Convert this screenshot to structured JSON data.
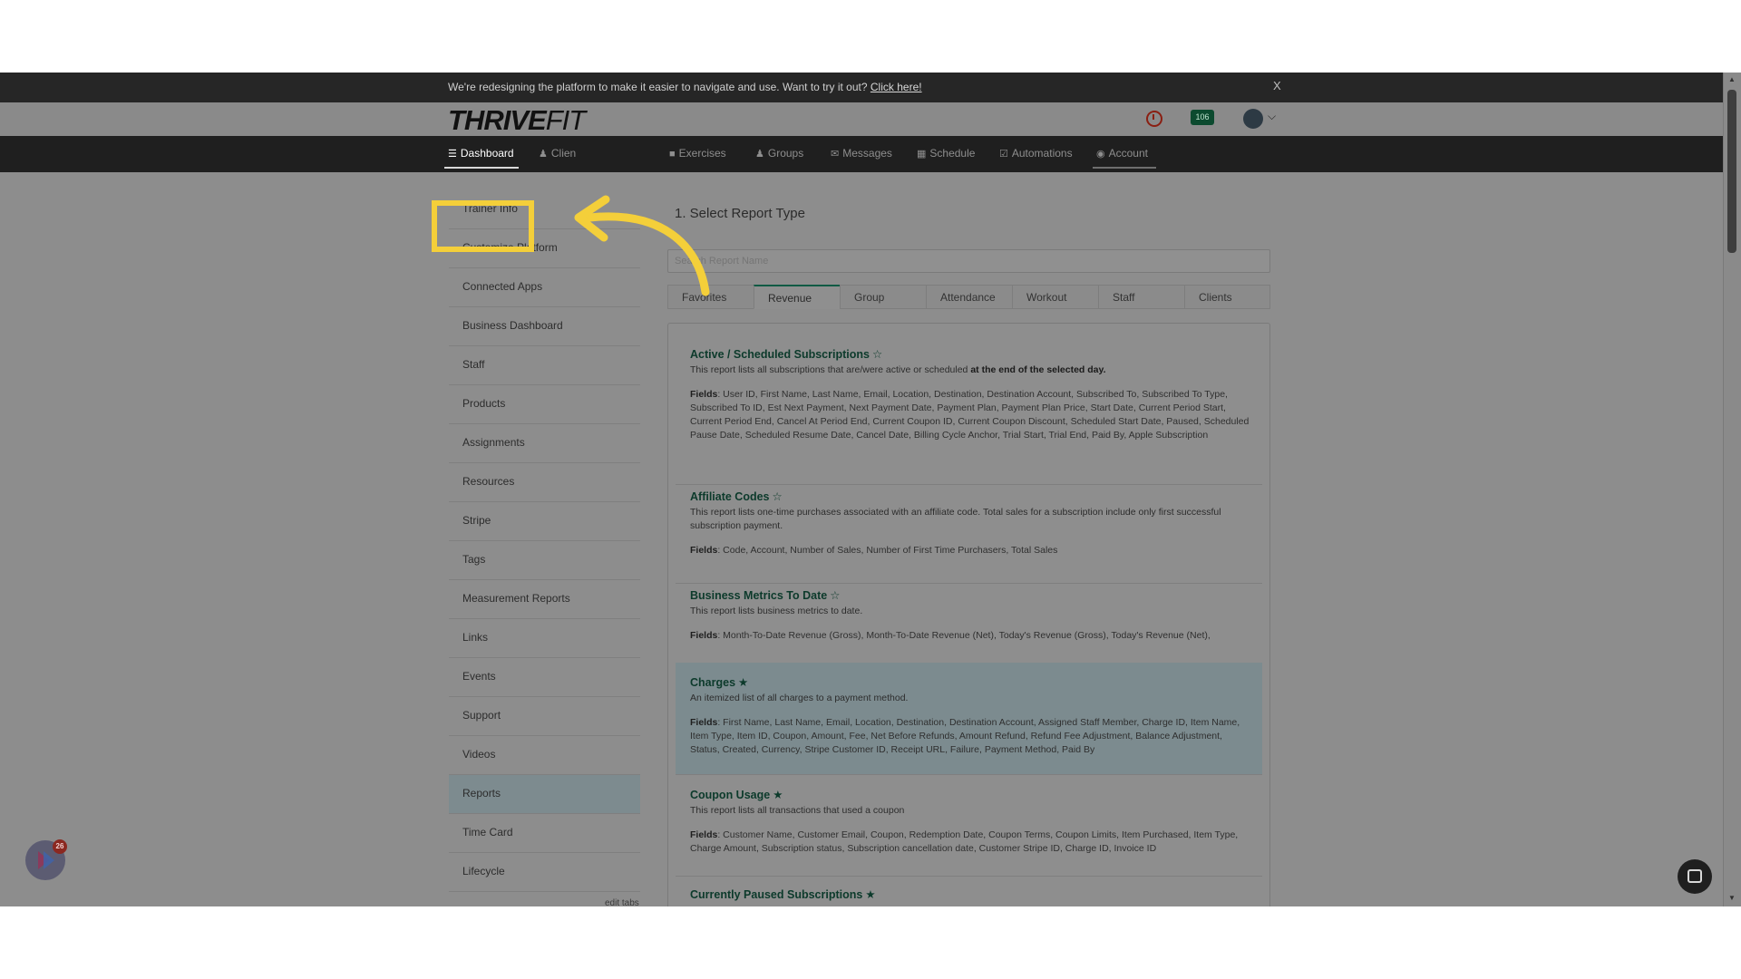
{
  "announcement": {
    "text": "We're redesigning the platform to make it easier to navigate and use. Want to try it out?",
    "link": "Click here!",
    "close": "X"
  },
  "header": {
    "logo_main": "THRIVE",
    "logo_accent": "FIT",
    "notification_count": "106"
  },
  "nav": {
    "items": [
      {
        "label": "Dashboard",
        "icon": "list-icon"
      },
      {
        "label": "Clien",
        "icon": "user-icon"
      },
      {
        "label": "Exercises",
        "icon": "dumbbell-icon"
      },
      {
        "label": "Groups",
        "icon": "users-icon"
      },
      {
        "label": "Messages",
        "icon": "envelope-icon"
      },
      {
        "label": "Schedule",
        "icon": "calendar-icon"
      },
      {
        "label": "Automations",
        "icon": "check-square-icon"
      },
      {
        "label": "Account",
        "icon": "user-circle-icon"
      }
    ]
  },
  "sidebar": {
    "items": [
      "Trainer Info",
      "Customize Platform",
      "Connected Apps",
      "Business Dashboard",
      "Staff",
      "Products",
      "Assignments",
      "Resources",
      "Stripe",
      "Tags",
      "Measurement Reports",
      "Links",
      "Events",
      "Support",
      "Videos",
      "Reports",
      "Time Card",
      "Lifecycle"
    ],
    "active": "Reports",
    "edit_tabs": "edit tabs"
  },
  "main": {
    "title": "1. Select Report Type",
    "search_placeholder": "Search Report Name",
    "tabs": [
      "Favorites",
      "Revenue",
      "Group",
      "Attendance",
      "Workout",
      "Staff",
      "Clients"
    ],
    "active_tab": "Revenue",
    "reports": [
      {
        "title": "Active / Scheduled Subscriptions",
        "star": "☆",
        "desc": "This report lists all subscriptions that are/were active or scheduled",
        "desc_bold": "at the end of the selected day.",
        "fields_label": "Fields",
        "fields": ": User ID, First Name, Last Name, Email, Location, Destination, Destination Account, Subscribed To, Subscribed To Type, Subscribed To ID, Est Next Payment, Next Payment Date, Payment Plan, Payment Plan Price, Start Date, Current Period Start, Current Period End, Cancel At Period End, Current Coupon ID, Current Coupon Discount, Scheduled Start Date, Paused, Scheduled Pause Date, Scheduled Resume Date, Cancel Date, Billing Cycle Anchor, Trial Start, Trial End, Paid By, Apple Subscription"
      },
      {
        "title": "Affiliate Codes",
        "star": "☆",
        "desc": "This report lists one-time purchases associated with an affiliate code. Total sales for a subscription include only first successful subscription payment.",
        "desc_bold": "",
        "fields_label": "Fields",
        "fields": ": Code, Account, Number of Sales, Number of First Time Purchasers, Total Sales"
      },
      {
        "title": "Business Metrics To Date",
        "star": "☆",
        "desc": "This report lists business metrics to date.",
        "desc_bold": "",
        "fields_label": "Fields",
        "fields": ": Month-To-Date Revenue (Gross), Month-To-Date Revenue (Net), Today's Revenue (Gross), Today's Revenue (Net),"
      },
      {
        "title": "Charges",
        "star": "★",
        "desc": "An itemized list of all charges to a payment method.",
        "desc_bold": "",
        "fields_label": "Fields",
        "fields": ": First Name, Last Name, Email, Location, Destination, Destination Account, Assigned Staff Member, Charge ID, Item Name, Item Type, Item ID, Coupon, Amount, Fee, Net Before Refunds, Amount Refund, Refund Fee Adjustment, Balance Adjustment, Status, Created, Currency, Stripe Customer ID, Receipt URL, Failure, Payment Method, Paid By"
      },
      {
        "title": "Coupon Usage",
        "star": "★",
        "desc": "This report lists all transactions that used a coupon",
        "desc_bold": "",
        "fields_label": "Fields",
        "fields": ": Customer Name, Customer Email, Coupon, Redemption Date, Coupon Terms, Coupon Limits, Item Purchased, Item Type, Charge Amount, Subscription status, Subscription cancellation date, Customer Stripe ID, Charge ID, Invoice ID"
      },
      {
        "title": "Currently Paused Subscriptions",
        "star": "★",
        "desc": "",
        "desc_bold": "",
        "fields_label": "",
        "fields": ""
      }
    ]
  },
  "widgets": {
    "launcher_badge": "26"
  },
  "colors": {
    "highlight": "#f4cf3a",
    "report_title": "#0c3a2b",
    "nav_bg": "#1f1f1f"
  }
}
